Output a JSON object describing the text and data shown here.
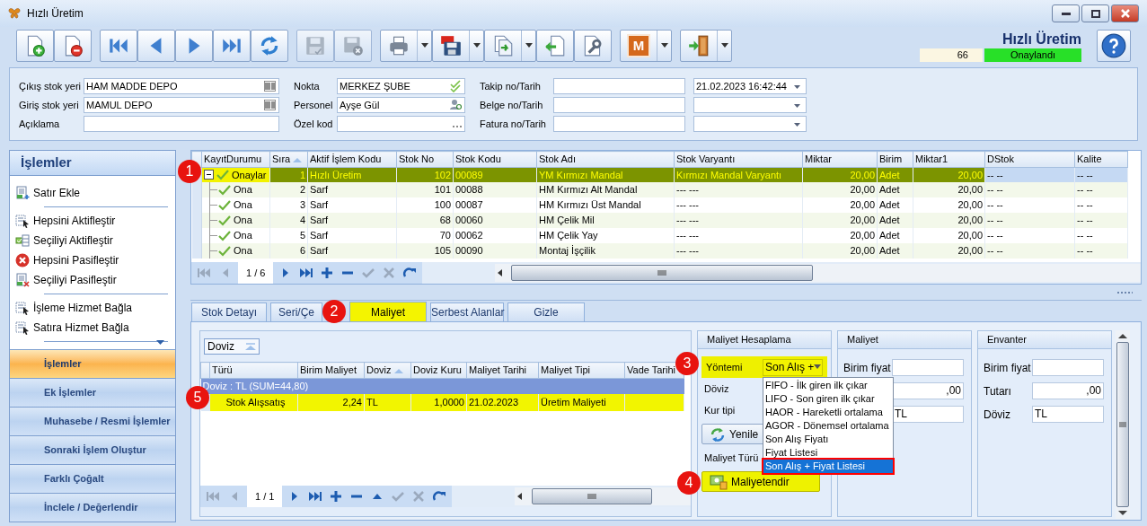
{
  "window": {
    "title": "Hızlı Üretim"
  },
  "toolbar": {
    "badge_letter": "M",
    "groups": [
      [
        {
          "kind": "new",
          "disabled": false,
          "dropdown": false
        },
        {
          "kind": "delete",
          "disabled": false,
          "dropdown": false
        }
      ],
      [
        {
          "kind": "first",
          "disabled": false,
          "dropdown": false
        },
        {
          "kind": "prev",
          "disabled": false,
          "dropdown": false
        },
        {
          "kind": "next",
          "disabled": false,
          "dropdown": false
        },
        {
          "kind": "last",
          "disabled": false,
          "dropdown": false
        },
        {
          "kind": "refresh",
          "disabled": false,
          "dropdown": false
        }
      ],
      [
        {
          "kind": "save",
          "disabled": true,
          "dropdown": false
        },
        {
          "kind": "save_close",
          "disabled": true,
          "dropdown": false
        }
      ],
      [
        {
          "kind": "print",
          "disabled": false,
          "dropdown": true
        },
        {
          "kind": "pdf",
          "disabled": false,
          "dropdown": true
        },
        {
          "kind": "export",
          "disabled": false,
          "dropdown": true
        },
        {
          "kind": "import",
          "disabled": false,
          "dropdown": false
        },
        {
          "kind": "tools",
          "disabled": false,
          "dropdown": false
        }
      ],
      [
        {
          "kind": "m",
          "disabled": false,
          "dropdown": true
        }
      ],
      [
        {
          "kind": "exit",
          "disabled": false,
          "dropdown": true
        }
      ]
    ]
  },
  "header": {
    "title": "Hızlı Üretim",
    "record_no": "66",
    "status": "Onaylandı"
  },
  "form": {
    "columns": [
      [
        {
          "label": "Çıkış stok yeri",
          "value": "HAM MADDE DEPO",
          "kind": "lookup"
        },
        {
          "label": "Giriş stok yeri",
          "value": "MAMUL DEPO",
          "kind": "lookup"
        },
        {
          "label": "Açıklama",
          "kind": "text"
        }
      ],
      [
        {
          "label": "Nokta",
          "value": "MERKEZ ŞUBE",
          "kind": "check"
        },
        {
          "label": "Personel",
          "value": "Ayşe Gül",
          "kind": "person"
        },
        {
          "label": "Özel kod",
          "kind": "ellipsis"
        }
      ],
      [
        {
          "label": "Takip no/Tarih",
          "kind": "text"
        },
        {
          "label": "Belge no/Tarih",
          "kind": "text"
        },
        {
          "label": "Fatura no/Tarih",
          "kind": "text"
        }
      ],
      [
        {
          "value": "21.02.2023 16:42:44",
          "kind": "combo"
        },
        {
          "kind": "combo"
        },
        {
          "kind": "combo"
        }
      ]
    ]
  },
  "sidebar": {
    "title": "İşlemler",
    "items": [
      {
        "kind": "add",
        "label": "Satır Ekle"
      },
      {
        "kind": "divider"
      },
      {
        "kind": "select",
        "label": "Hepsini Aktifleştir"
      },
      {
        "kind": "check",
        "label": "Seçiliyi Aktifleştir"
      },
      {
        "kind": "stop",
        "label": "Hepsini Pasifleştir"
      },
      {
        "kind": "remove",
        "label": "Seçiliyi Pasifleştir"
      },
      {
        "kind": "divider"
      },
      {
        "kind": "select",
        "label": "İşleme Hizmet Bağla"
      },
      {
        "kind": "select",
        "label": "Satıra Hizmet Bağla"
      },
      {
        "kind": "divider"
      }
    ],
    "sections": [
      {
        "label": "İşlemler",
        "selected": true
      },
      {
        "label": "Ek İşlemler",
        "selected": false
      },
      {
        "label": "Muhasebe / Resmi İşlemler",
        "selected": false
      },
      {
        "label": "Sonraki İşlem Oluştur",
        "selected": false
      },
      {
        "label": "Farklı Çoğalt",
        "selected": false
      },
      {
        "label": "İnclele / Değerlendir",
        "selected": false
      }
    ]
  },
  "grid": {
    "columns": [
      {
        "label": "KayıtDurumu",
        "sorted": false
      },
      {
        "label": "Sıra",
        "sorted": true
      },
      {
        "label": "Aktif İşlem Kodu",
        "sorted": false
      },
      {
        "label": "Stok No",
        "sorted": false
      },
      {
        "label": "Stok Kodu",
        "sorted": false
      },
      {
        "label": "Stok Adı",
        "sorted": false
      },
      {
        "label": "Stok Varyantı",
        "sorted": false
      },
      {
        "label": "Miktar",
        "sorted": false
      },
      {
        "label": "Birim",
        "sorted": false
      },
      {
        "label": "Miktar1",
        "sorted": false
      },
      {
        "label": "DStok",
        "sorted": false
      },
      {
        "label": "Kalite",
        "sorted": false
      }
    ],
    "rows": [
      {
        "selected": true,
        "expanded": true,
        "cells": [
          "Onaylar",
          "1",
          "Hızlı Üretim",
          "102",
          "00089",
          "YM Kırmızı Mandal",
          "Kırmızı Mandal Varyantı",
          "20,00",
          "Adet",
          "20,00",
          "-- --",
          "-- --"
        ],
        "children": [
          {
            "selected": false,
            "cells": [
              "Ona",
              "2",
              "Sarf",
              "101",
              "00088",
              "HM Kırmızı Alt Mandal",
              "--- ---",
              "20,00",
              "Adet",
              "20,00",
              "-- --",
              "-- --"
            ]
          },
          {
            "selected": false,
            "cells": [
              "Ona",
              "3",
              "Sarf",
              "100",
              "00087",
              "HM Kırmızı Üst Mandal",
              "--- ---",
              "20,00",
              "Adet",
              "20,00",
              "-- --",
              "-- --"
            ]
          },
          {
            "selected": false,
            "cells": [
              "Ona",
              "4",
              "Sarf",
              "68",
              "00060",
              "HM Çelik Mil",
              "--- ---",
              "20,00",
              "Adet",
              "20,00",
              "-- --",
              "-- --"
            ]
          },
          {
            "selected": false,
            "cells": [
              "Ona",
              "5",
              "Sarf",
              "70",
              "00062",
              "HM Çelik Yay",
              "--- ---",
              "20,00",
              "Adet",
              "20,00",
              "-- --",
              "-- --"
            ]
          },
          {
            "selected": false,
            "cells": [
              "Ona",
              "6",
              "Sarf",
              "105",
              "00090",
              "Montaj İşçilik",
              "--- ---",
              "20,00",
              "Adet",
              "20,00",
              "-- --",
              "-- --"
            ]
          }
        ]
      }
    ],
    "pager": "1 / 6"
  },
  "tabs": [
    {
      "label": "Stok Detayı",
      "selected": false
    },
    {
      "label": "Seri/Çe",
      "selected": false
    },
    {
      "label": "Maliyet",
      "selected": true
    },
    {
      "label": "Serbest Alanlar",
      "selected": false
    },
    {
      "label": "Gizle",
      "selected": false
    }
  ],
  "cost_grid": {
    "group_by": "Doviz",
    "columns": [
      {
        "label": "Türü",
        "sorted": false
      },
      {
        "label": "Birim Maliyet",
        "sorted": false
      },
      {
        "label": "Doviz",
        "sorted": true
      },
      {
        "label": "Doviz Kuru",
        "sorted": false
      },
      {
        "label": "Maliyet Tarihi",
        "sorted": false
      },
      {
        "label": "Maliyet Tipi",
        "sorted": false
      },
      {
        "label": "Vade Tarihi",
        "sorted": false
      }
    ],
    "group_row": "Doviz : TL (SUM=44,80)",
    "rows": [
      {
        "selected": true,
        "cells": [
          "Stok Alışsatış",
          "2,24",
          "TL",
          "1,0000",
          "21.02.2023",
          "Üretim Maliyeti"
        ]
      }
    ],
    "pager": "1 / 1"
  },
  "cost_calc": {
    "title": "Maliyet Hesaplama",
    "fields": [
      {
        "kind": "combo",
        "label": "Yöntemi",
        "value": "Son Alış +",
        "highlighted": true
      },
      {
        "kind": "label",
        "label": "Döviz"
      },
      {
        "kind": "label",
        "label": "Kur tipi"
      },
      {
        "kind": "button",
        "label": "Yenile",
        "highlighted": false
      },
      {
        "kind": "label",
        "label": "Maliyet Türü"
      },
      {
        "kind": "button",
        "label": "Maliyetendir",
        "highlighted": true
      }
    ],
    "dropdown": [
      {
        "label": "FIFO - İlk giren ilk çıkar",
        "selected": false
      },
      {
        "label": "LIFO - Son giren ilk çıkar",
        "selected": false
      },
      {
        "label": "HAOR - Hareketli ortalama",
        "selected": false
      },
      {
        "label": "AGOR - Dönemsel ortalama",
        "selected": false
      },
      {
        "label": "Son Alış Fiyatı",
        "selected": false
      },
      {
        "label": "Fiyat Listesi",
        "selected": false
      },
      {
        "label": "Son Alış + Fiyat Listesi",
        "selected": true
      }
    ]
  },
  "panels": [
    {
      "title": "Maliyet",
      "fields": [
        {
          "label": "Birim fiyat",
          "kind": "text"
        },
        {
          "value": ",00",
          "kind": "number"
        },
        {
          "value": "TL",
          "kind": "text"
        }
      ]
    },
    {
      "title": "Envanter",
      "fields": [
        {
          "label": "Birim fiyat",
          "kind": "text"
        },
        {
          "label": "Tutarı",
          "value": ",00",
          "kind": "number"
        },
        {
          "label": "Döviz",
          "value": "TL",
          "kind": "text"
        }
      ]
    }
  ],
  "annotations": [
    {
      "label": "1"
    },
    {
      "label": "2"
    },
    {
      "label": "3"
    },
    {
      "label": "4"
    },
    {
      "label": "5"
    }
  ]
}
